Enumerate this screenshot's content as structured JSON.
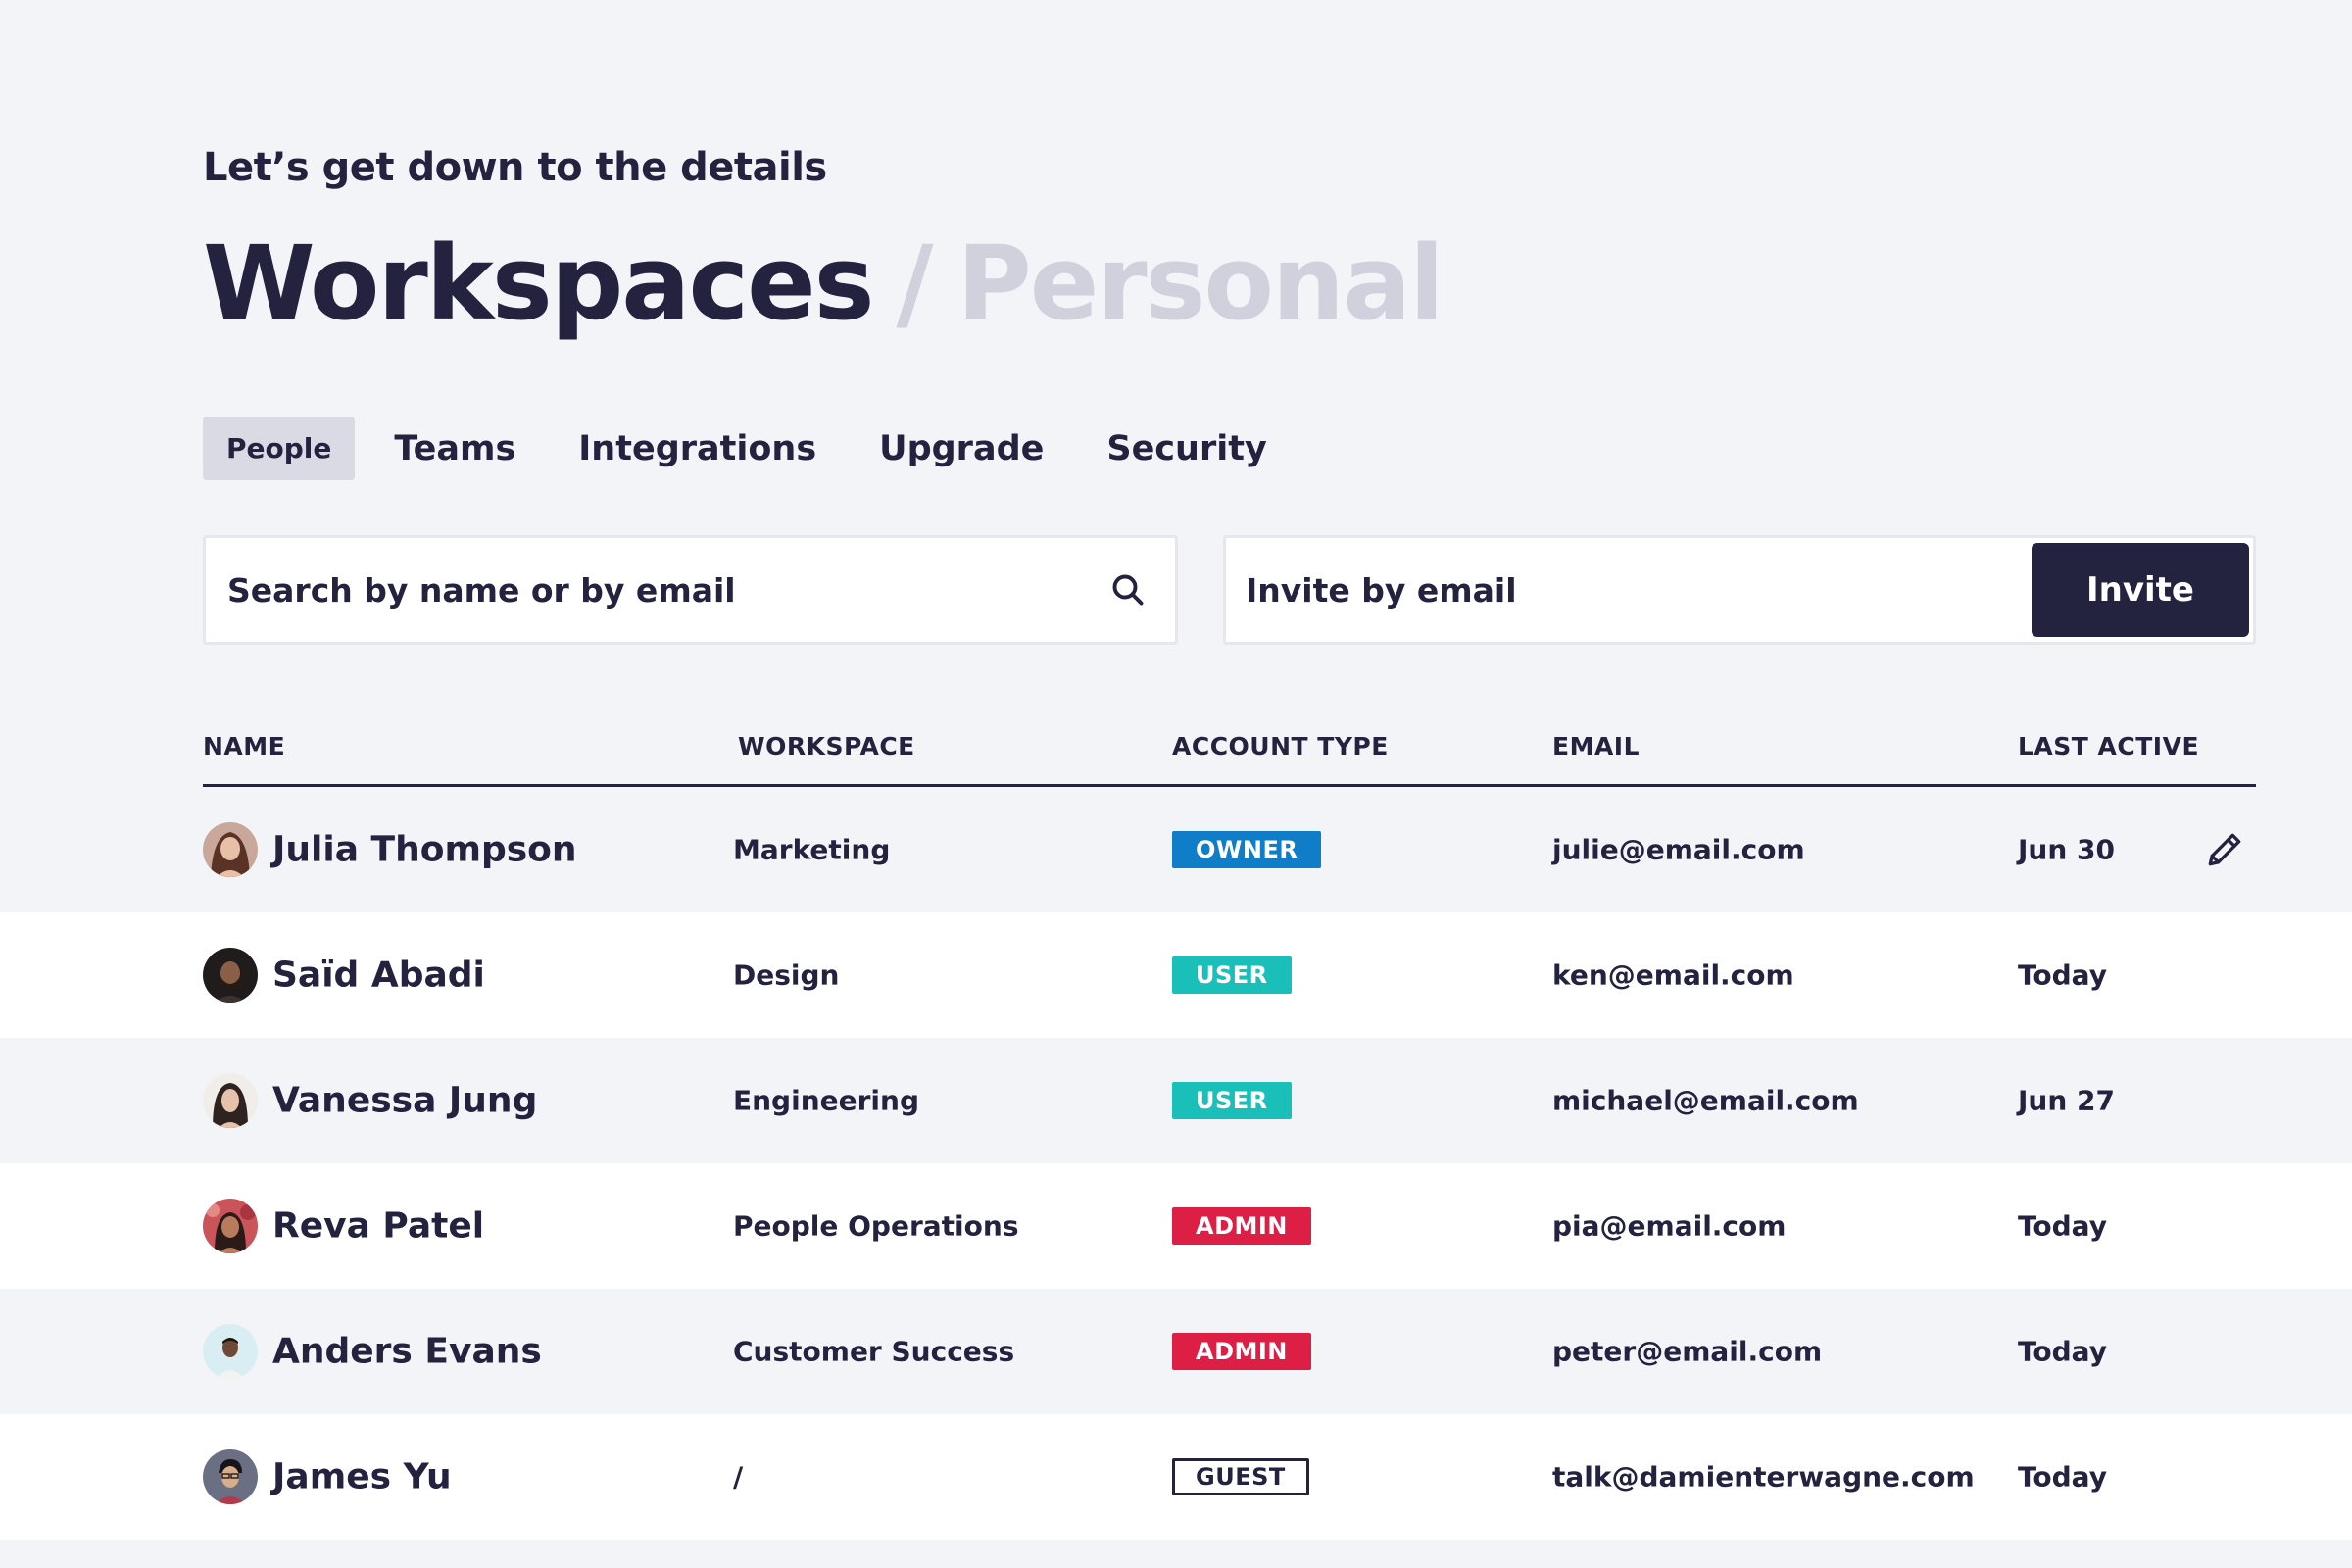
{
  "header": {
    "eyebrow": "Let’s get down to the details",
    "title": "Workspaces",
    "separator": "/",
    "subtitle": "Personal"
  },
  "tabs": [
    {
      "label": "People",
      "active": true
    },
    {
      "label": "Teams",
      "active": false
    },
    {
      "label": "Integrations",
      "active": false
    },
    {
      "label": "Upgrade",
      "active": false
    },
    {
      "label": "Security",
      "active": false
    }
  ],
  "search": {
    "placeholder": "Search by name or by email",
    "value": "",
    "icon": "search-icon"
  },
  "invite": {
    "placeholder": "Invite by email",
    "value": "",
    "button_label": "Invite"
  },
  "table": {
    "headers": {
      "name": "NAME",
      "workspace": "WORKSPACE",
      "account_type": "ACCOUNT TYPE",
      "email": "EMAIL",
      "last_active": "LAST ACTIVE"
    },
    "rows": [
      {
        "name": "Julia Thompson",
        "workspace": "Marketing",
        "account_type": "OWNER",
        "email": "julie@email.com",
        "last_active": "Jun 30"
      },
      {
        "name": "Saïd Abadi",
        "workspace": "Design",
        "account_type": "USER",
        "email": "ken@email.com",
        "last_active": "Today"
      },
      {
        "name": "Vanessa Jung",
        "workspace": "Engineering",
        "account_type": "USER",
        "email": "michael@email.com",
        "last_active": "Jun 27"
      },
      {
        "name": "Reva Patel",
        "workspace": "People Operations",
        "account_type": "ADMIN",
        "email": "pia@email.com",
        "last_active": "Today"
      },
      {
        "name": "Anders Evans",
        "workspace": "Customer Success",
        "account_type": "ADMIN",
        "email": "peter@email.com",
        "last_active": "Today"
      },
      {
        "name": "James Yu",
        "workspace": "/",
        "account_type": "GUEST",
        "email": "talk@damienterwagne.com",
        "last_active": "Today"
      }
    ]
  },
  "colors": {
    "background": "#f3f4f8",
    "ink": "#23223f",
    "muted": "#d0d1dc",
    "owner": "#0f7dc7",
    "user": "#1bbfba",
    "admin": "#dd1f46"
  }
}
